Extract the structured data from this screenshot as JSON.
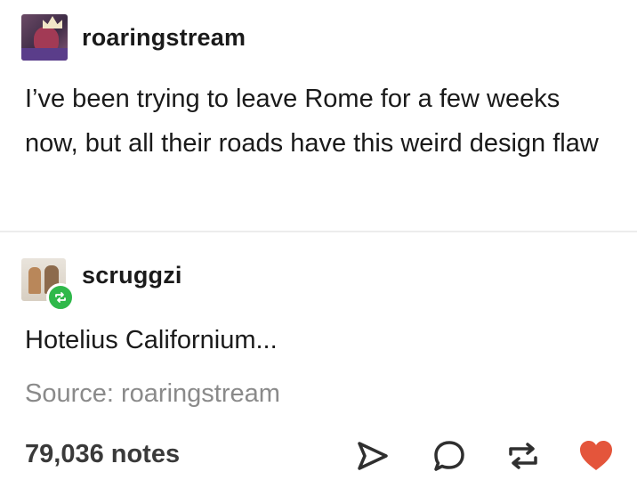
{
  "post": {
    "author": "roaringstream",
    "text": "I’ve been trying to leave Rome for a few weeks now, but all their roads have this weird design flaw"
  },
  "reblog": {
    "author": "scruggzi",
    "text": "Hotelius Californium...",
    "source": "Source: roaringstream"
  },
  "footer": {
    "notes": "79,036 notes",
    "icons": [
      "share-icon",
      "reply-icon",
      "reblog-icon",
      "heart-icon"
    ]
  },
  "colors": {
    "text": "#1a1a1a",
    "muted": "#8a8a8a",
    "reblog_badge": "#2fb84a",
    "heart": "#e4553b"
  }
}
